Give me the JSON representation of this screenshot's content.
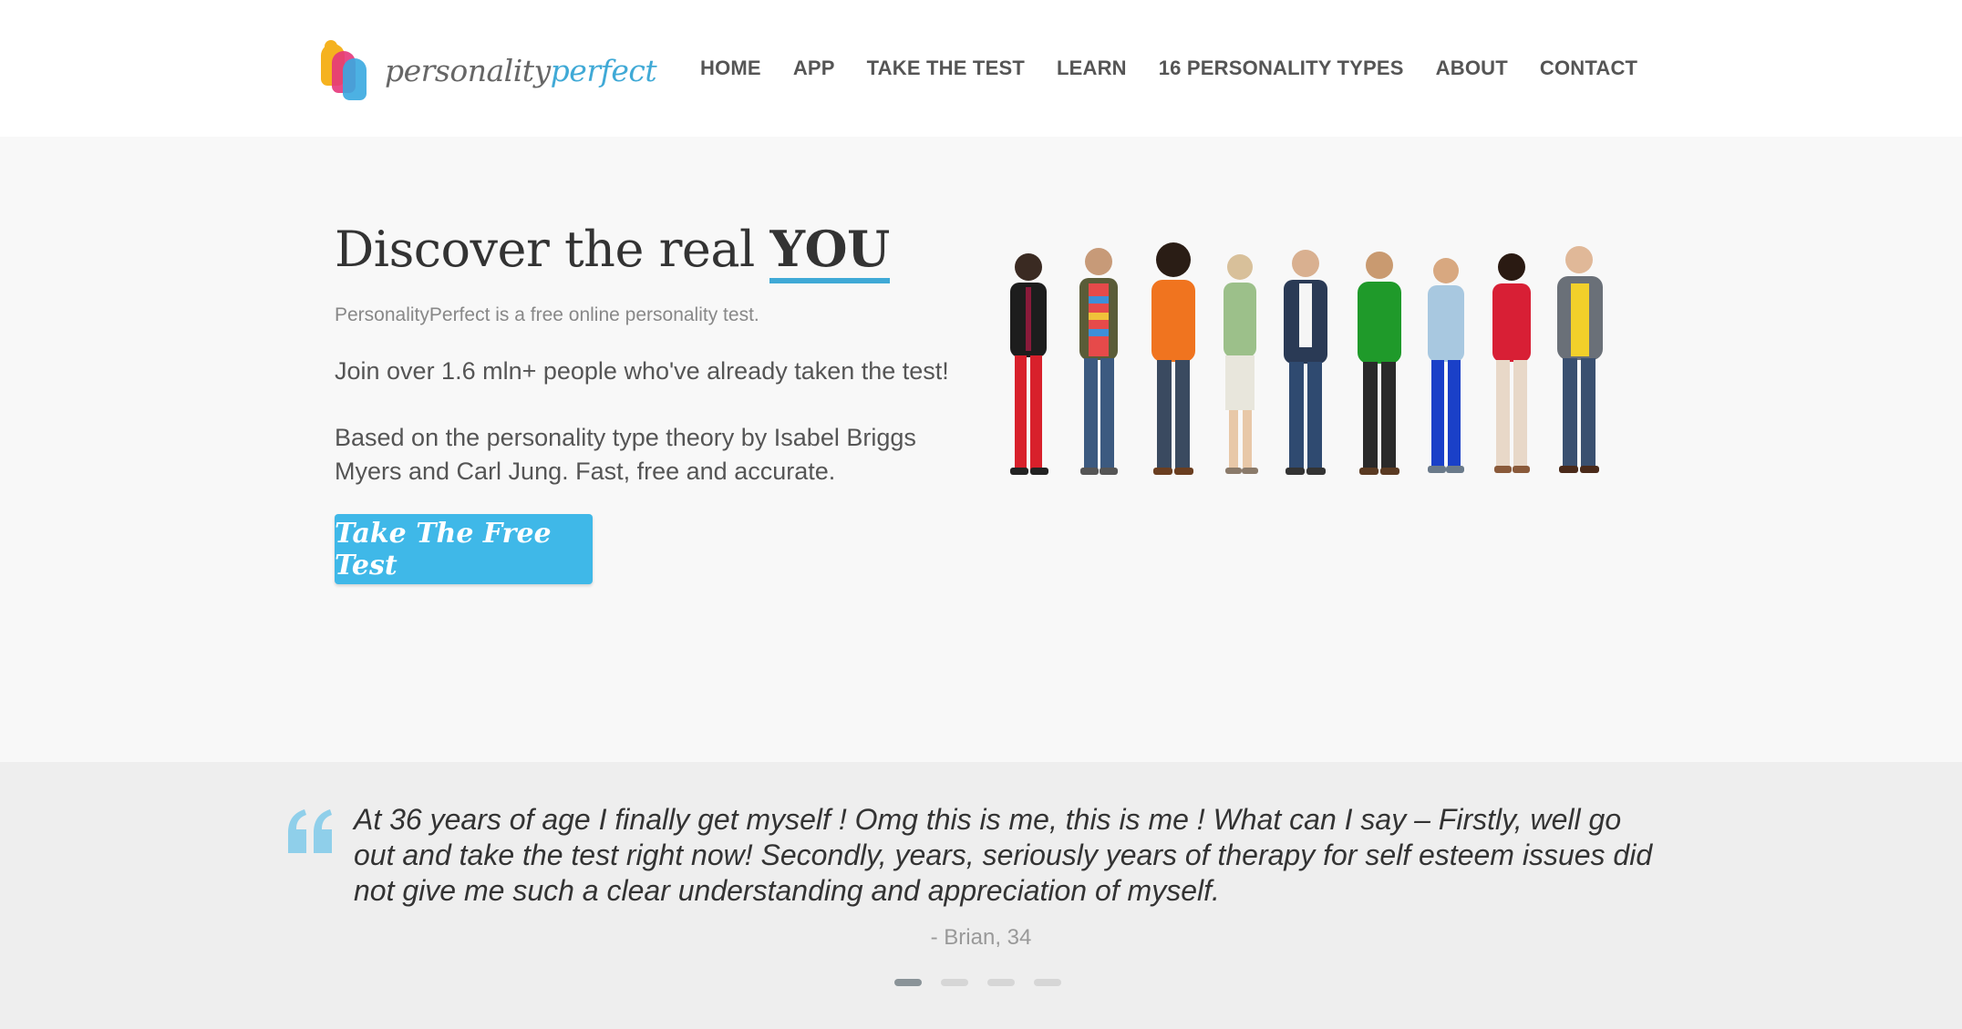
{
  "brand": {
    "part1": "personality",
    "part2": "perfect"
  },
  "nav": {
    "items": [
      "HOME",
      "APP",
      "TAKE THE TEST",
      "LEARN",
      "16 PERSONALITY TYPES",
      "ABOUT",
      "CONTACT"
    ]
  },
  "hero": {
    "title_prefix": "Discover the real ",
    "title_emphasis": "YOU",
    "subtitle": "PersonalityPerfect is a free online personality test.",
    "join_text": "Join over 1.6 mln+ people who've already taken the test!",
    "based_text": "Based on the personality type theory by Isabel Briggs Myers and Carl Jung. Fast, free and accurate.",
    "cta_label": "Take The Free Test"
  },
  "testimonial": {
    "quote": "At 36 years of age I finally get myself ! Omg this is me, this is me ! What can I say – Firstly, well go out and take the test right now! Secondly, years, seriously years of therapy for self esteem issues did not give me such a clear understanding and appreciation of myself.",
    "author": "- Brian, 34",
    "active_slide": 1,
    "slide_count": 4
  },
  "colors": {
    "accent": "#3fa9d6",
    "cta_bg": "#3fb8e8",
    "hero_bg": "#f8f8f8",
    "testimonial_bg": "#eeeeee"
  },
  "icons": [
    "logo-mark-icon",
    "quote-icon"
  ]
}
